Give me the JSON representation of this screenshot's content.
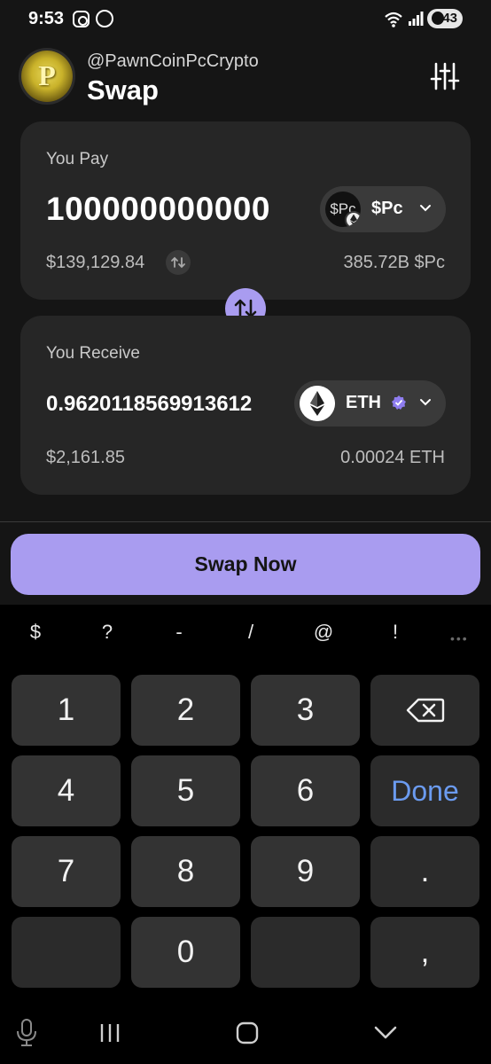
{
  "status_bar": {
    "time": "9:53",
    "battery": "43",
    "wifi_badge": "5"
  },
  "header": {
    "handle": "@PawnCoinPcCrypto",
    "title": "Swap",
    "logo_letter": "P"
  },
  "pay": {
    "label": "You Pay",
    "amount": "100000000000",
    "token_icon_text": "$Pc",
    "token": "$Pc",
    "usd_value": "$139,129.84",
    "balance": "385.72B $Pc"
  },
  "receive": {
    "label": "You Receive",
    "amount": "0.9620118569913612",
    "token": "ETH",
    "usd_value": "$2,161.85",
    "balance": "0.00024 ETH"
  },
  "swap_button": "Swap Now",
  "colors": {
    "accent": "#a99cf0",
    "card": "#262626",
    "done_key": "#6b9bf0"
  },
  "keyboard": {
    "symbols": [
      "$",
      "?",
      "-",
      "/",
      "@",
      "!"
    ],
    "more": "•••",
    "keys": [
      "1",
      "2",
      "3",
      "4",
      "5",
      "6",
      "Done",
      "7",
      "8",
      "9",
      ".",
      "0",
      ","
    ]
  }
}
